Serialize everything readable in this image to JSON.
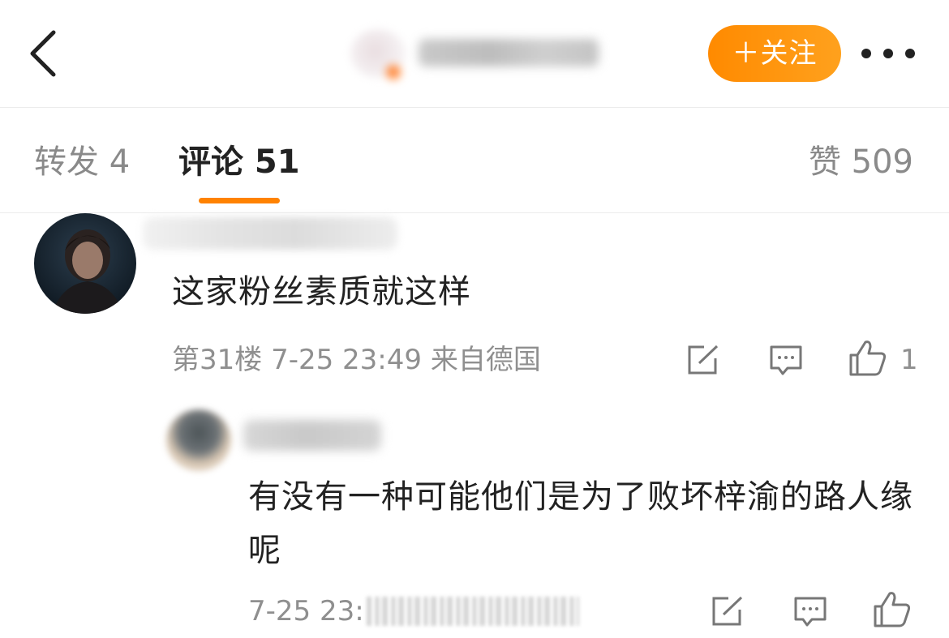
{
  "header": {
    "back_icon": "chevron-left-icon",
    "follow_label": "＋关注",
    "more_icon": "more-dots-icon"
  },
  "tabs": {
    "repost": "转发 4",
    "comment": "评论 51",
    "like": "赞 509"
  },
  "comments": [
    {
      "text": "这家粉丝素质就这样",
      "meta": "第31楼 7-25 23:49 来自德国",
      "like_count": "1",
      "icons": [
        "edit-icon",
        "comment-icon",
        "thumbs-up-icon"
      ]
    },
    {
      "text": "有没有一种可能他们是为了败坏梓渝的路人缘呢",
      "meta": "7-25 23:",
      "icons": [
        "edit-icon",
        "comment-icon",
        "thumbs-up-icon"
      ]
    }
  ],
  "colors": {
    "accent": "#ff8200",
    "text": "#222222",
    "secondary": "#8f8f8f",
    "divider": "#ececec"
  }
}
